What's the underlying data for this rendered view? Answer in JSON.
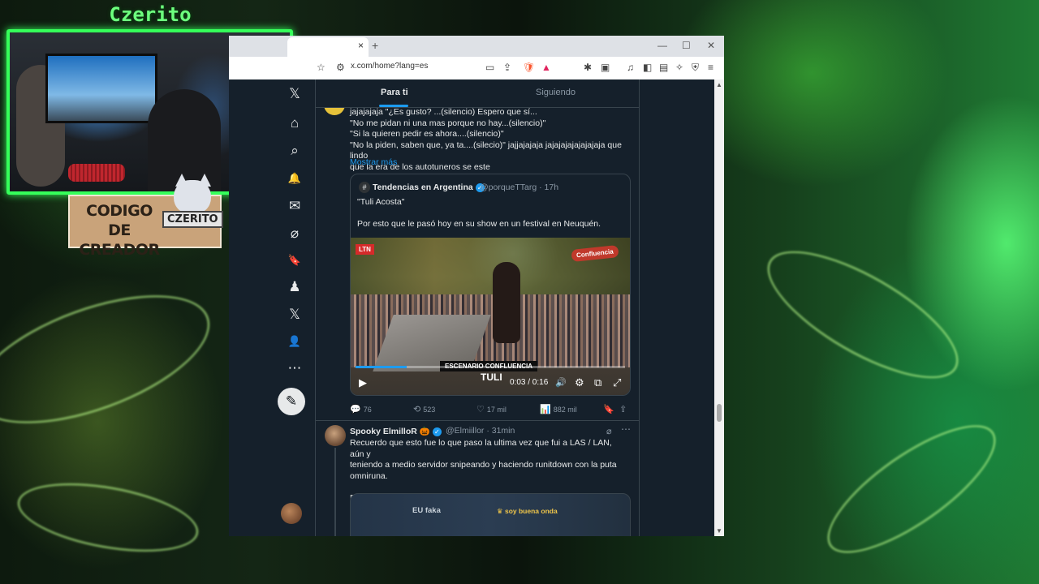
{
  "overlay": {
    "streamer_name": "Czerito",
    "creator_code_text": "CODIGO DE CREADOR",
    "creator_code_name": "CZERITO"
  },
  "browser": {
    "url": "x.com/home?lang=es",
    "tab_close": "×",
    "new_tab": "+",
    "minimize": "—",
    "maximize": "☐",
    "close": "✕"
  },
  "feed": {
    "tabs": [
      {
        "label": "Para ti",
        "active": true
      },
      {
        "label": "Siguiendo",
        "active": false
      }
    ]
  },
  "post1": {
    "body": "jajajajaja \"¿Es gusto? ...(silencio) Espero que sí...\n\"No me pidan ni una mas porque no hay...(silencio)\"\n\"Si la quieren pedir es ahora....(silencio)\"\n\"No la piden, saben que, ya ta....(silecio)\" jajjajajaja jajajajajajajajaja que lindo\nque la era de los autotuneros se este",
    "show_more": "Mostrar más",
    "quote": {
      "avatar": "#",
      "name": "Tendencias en Argentina",
      "handle": "@porqueTTarg · 17h",
      "text1": "\"Tuli Acosta\"",
      "text2": "Por esto que le pasó hoy en su show en un festival en Neuquén.",
      "video": {
        "time": "0:03 / 0:16",
        "progress": 0.19,
        "channel_tag": "LTN",
        "logo_text": "Confluencia",
        "lower_third": "ESCENARIO CONFLUENCIA",
        "lower_name": "TULI"
      }
    },
    "actions": {
      "replies": "76",
      "reposts": "523",
      "likes": "17 mil",
      "views": "882 mil"
    }
  },
  "post2": {
    "name": "Spooky ElmilloR 🎃",
    "handle": "@Elmiillor · 31min",
    "body": "Recuerdo que esto fue lo que paso la ultima vez que fui a LAS / LAN, aún y\nteniendo a medio servidor snipeando y haciendo runitdown con la puta\nomniruna.\n\nBroma de servidor y de jugadores.",
    "media_left": "EU faka",
    "media_right": "♛ soy buena onda"
  },
  "icons": {
    "x_logo": "𝕏",
    "home": "⌂",
    "search": "⌕",
    "bell": "🔔",
    "mail": "✉",
    "grok": "⌀",
    "bookmark": "🔖",
    "communities": "♟",
    "premium": "𝕏",
    "profile": "👤",
    "more": "⋯",
    "compose": "✎",
    "reply": "💬",
    "repost": "⟲",
    "like": "♡",
    "views": "📊",
    "save": "🔖",
    "share": "⇪",
    "play": "▶",
    "volume": "🔊",
    "settings": "⚙",
    "pip": "⧉",
    "fullscreen": "⤢"
  },
  "colors": {
    "x_bg": "#15202b",
    "accent": "#1d9bf0",
    "overlay_green": "#35ff5a"
  }
}
